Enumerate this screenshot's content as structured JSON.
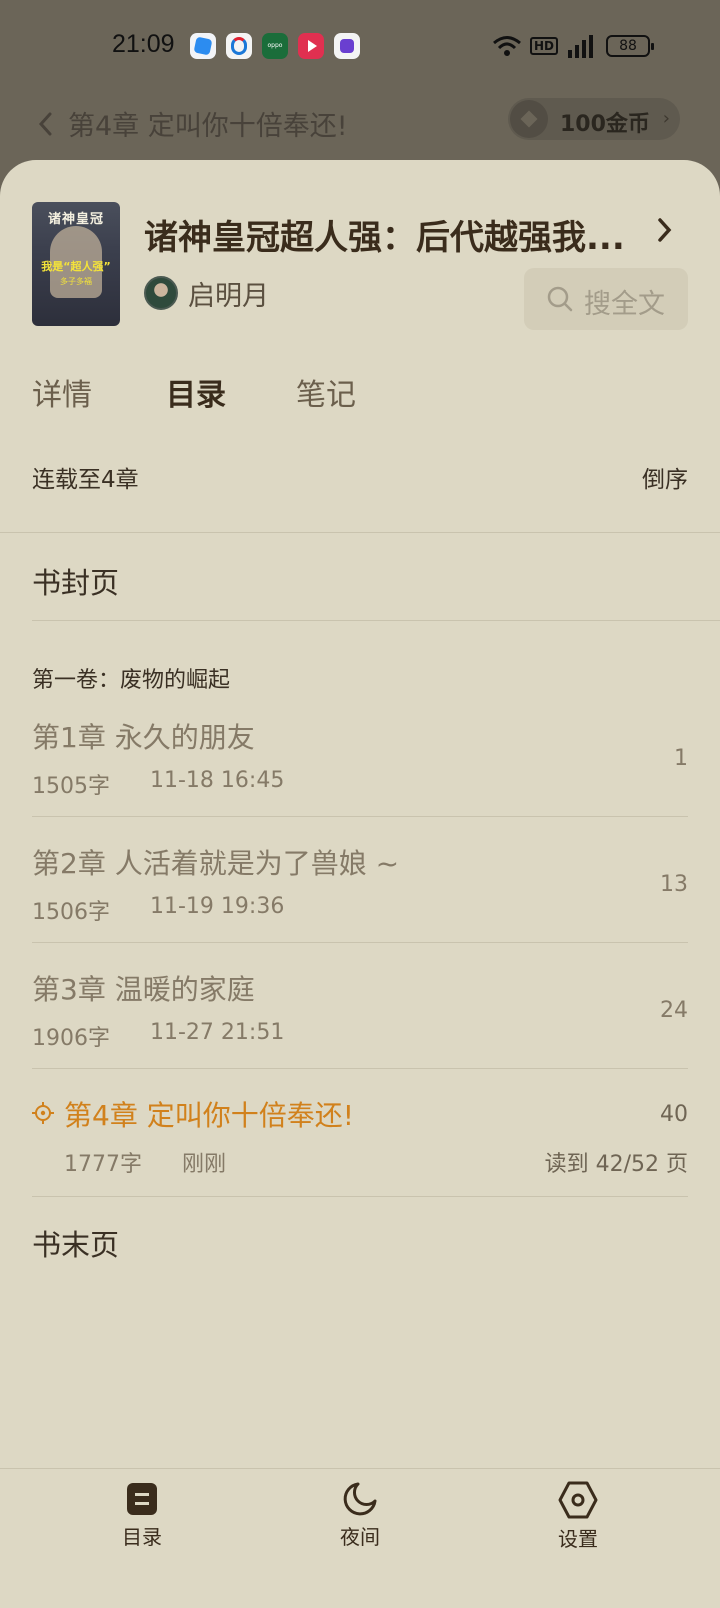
{
  "status_bar": {
    "time": "21:09",
    "battery": "88",
    "hd": "HD"
  },
  "reader_header": {
    "chapter_title": "第4章 定叫你十倍奉还!",
    "coins": "100金币"
  },
  "book": {
    "title": "诸神皇冠超人强：后代越强我...",
    "author": "启明月",
    "cover_title": "诸神皇冠",
    "cover_tag": "我是“超人强”",
    "cover_sub": "多子多福"
  },
  "search": {
    "label": "搜全文"
  },
  "tabs": [
    "详情",
    "目录",
    "笔记"
  ],
  "catalog": {
    "status": "连载至4章",
    "sort_label": "倒序",
    "front_page": "书封页",
    "end_page": "书末页",
    "volume": "第一卷：废物的崛起",
    "chapters": [
      {
        "title": "第1章 永久的朋友",
        "words": "1505字",
        "time": "11-18 16:45",
        "page": "1"
      },
      {
        "title": "第2章 人活着就是为了兽娘 ~",
        "words": "1506字",
        "time": "11-19 19:36",
        "page": "13"
      },
      {
        "title": "第3章 温暖的家庭",
        "words": "1906字",
        "time": "11-27 21:51",
        "page": "24"
      },
      {
        "title": "第4章 定叫你十倍奉还!",
        "words": "1777字",
        "time": "刚刚",
        "page": "40",
        "progress": "读到 42/52 页"
      }
    ]
  },
  "bottom_nav": [
    "目录",
    "夜间",
    "设置"
  ],
  "colors": {
    "sheet_bg": "#ddd8c4",
    "accent": "#d1811c",
    "text_dark": "#3a2c1c",
    "overlay": "#6b6558"
  }
}
